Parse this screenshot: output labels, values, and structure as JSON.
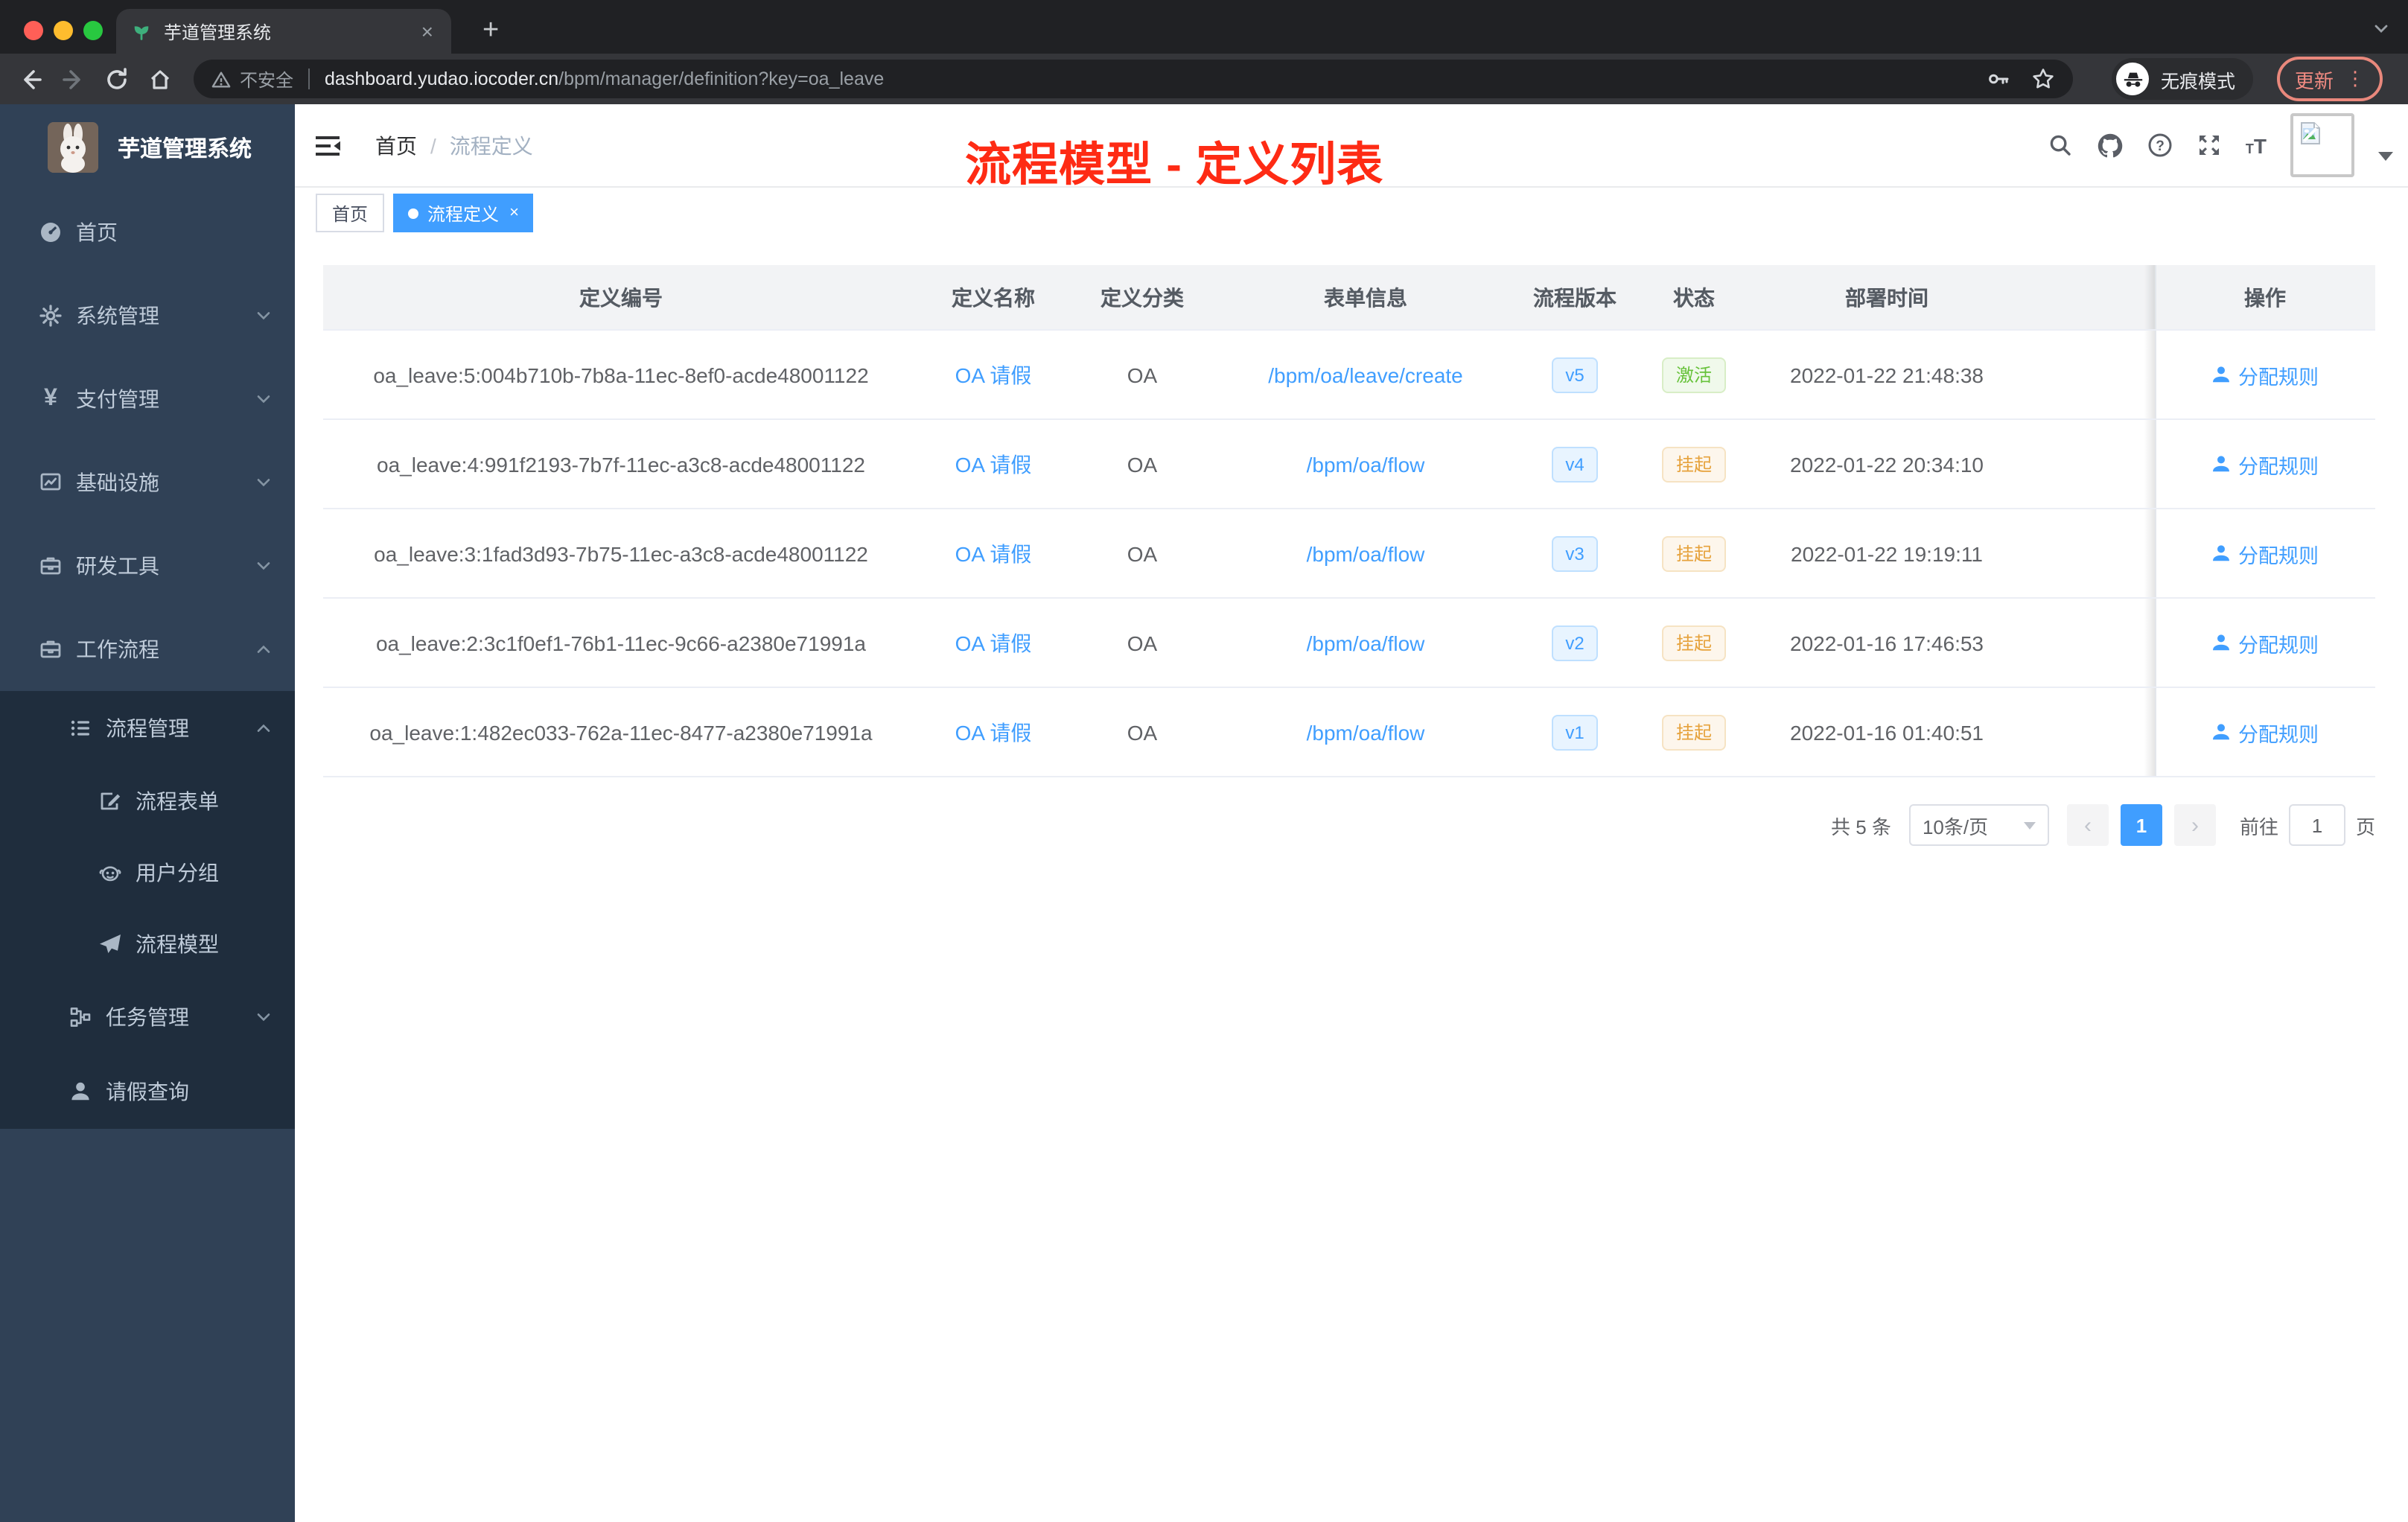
{
  "colors": {
    "accent": "#409eff",
    "annotation_red": "#fe2b14",
    "sidebar_bg": "#304156",
    "submenu_bg": "#1f2d3d",
    "success": "#67c23a",
    "warning": "#e6a23c",
    "update_red": "#f28b82"
  },
  "browser": {
    "tab_title": "芋道管理系统",
    "close_tab": "×",
    "new_tab": "+",
    "security": "不安全",
    "domain": "dashboard.yudao.iocoder.cn",
    "path": "/bpm/manager/definition?key=oa_leave",
    "incognito": "无痕模式",
    "update": "更新",
    "kebab": "⋮"
  },
  "sidebar": {
    "title": "芋道管理系统",
    "items": [
      {
        "label": "首页"
      },
      {
        "label": "系统管理"
      },
      {
        "label": "支付管理"
      },
      {
        "label": "基础设施"
      },
      {
        "label": "研发工具"
      },
      {
        "label": "工作流程"
      },
      {
        "label": "流程管理"
      },
      {
        "label": "流程表单"
      },
      {
        "label": "用户分组"
      },
      {
        "label": "流程模型"
      },
      {
        "label": "任务管理"
      },
      {
        "label": "请假查询"
      }
    ],
    "yen_glyph": "¥"
  },
  "navbar": {
    "breadcrumb_home": "首页",
    "breadcrumb_sep": "/",
    "breadcrumb_current": "流程定义"
  },
  "annotation": "流程模型 - 定义列表",
  "tags": {
    "home": "首页",
    "active": "流程定义",
    "close": "×"
  },
  "table": {
    "columns": [
      "定义编号",
      "定义名称",
      "定义分类",
      "表单信息",
      "流程版本",
      "状态",
      "部署时间",
      "操作"
    ],
    "rows": [
      {
        "id": "oa_leave:5:004b710b-7b8a-11ec-8ef0-acde48001122",
        "name": "OA 请假",
        "category": "OA",
        "form": "/bpm/oa/leave/create",
        "version": "v5",
        "status": "激活",
        "time": "2022-01-22 21:48:38",
        "action": "分配规则"
      },
      {
        "id": "oa_leave:4:991f2193-7b7f-11ec-a3c8-acde48001122",
        "name": "OA 请假",
        "category": "OA",
        "form": "/bpm/oa/flow",
        "version": "v4",
        "status": "挂起",
        "time": "2022-01-22 20:34:10",
        "action": "分配规则"
      },
      {
        "id": "oa_leave:3:1fad3d93-7b75-11ec-a3c8-acde48001122",
        "name": "OA 请假",
        "category": "OA",
        "form": "/bpm/oa/flow",
        "version": "v3",
        "status": "挂起",
        "time": "2022-01-22 19:19:11",
        "action": "分配规则"
      },
      {
        "id": "oa_leave:2:3c1f0ef1-76b1-11ec-9c66-a2380e71991a",
        "name": "OA 请假",
        "category": "OA",
        "form": "/bpm/oa/flow",
        "version": "v2",
        "status": "挂起",
        "time": "2022-01-16 17:46:53",
        "action": "分配规则"
      },
      {
        "id": "oa_leave:1:482ec033-762a-11ec-8477-a2380e71991a",
        "name": "OA 请假",
        "category": "OA",
        "form": "/bpm/oa/flow",
        "version": "v1",
        "status": "挂起",
        "time": "2022-01-16 01:40:51",
        "action": "分配规则"
      }
    ]
  },
  "pagination": {
    "total": "共 5 条",
    "page_size": "10条/页",
    "prev": "‹",
    "next": "›",
    "page": "1",
    "goto": "前往",
    "goto_value": "1",
    "unit": "页"
  }
}
